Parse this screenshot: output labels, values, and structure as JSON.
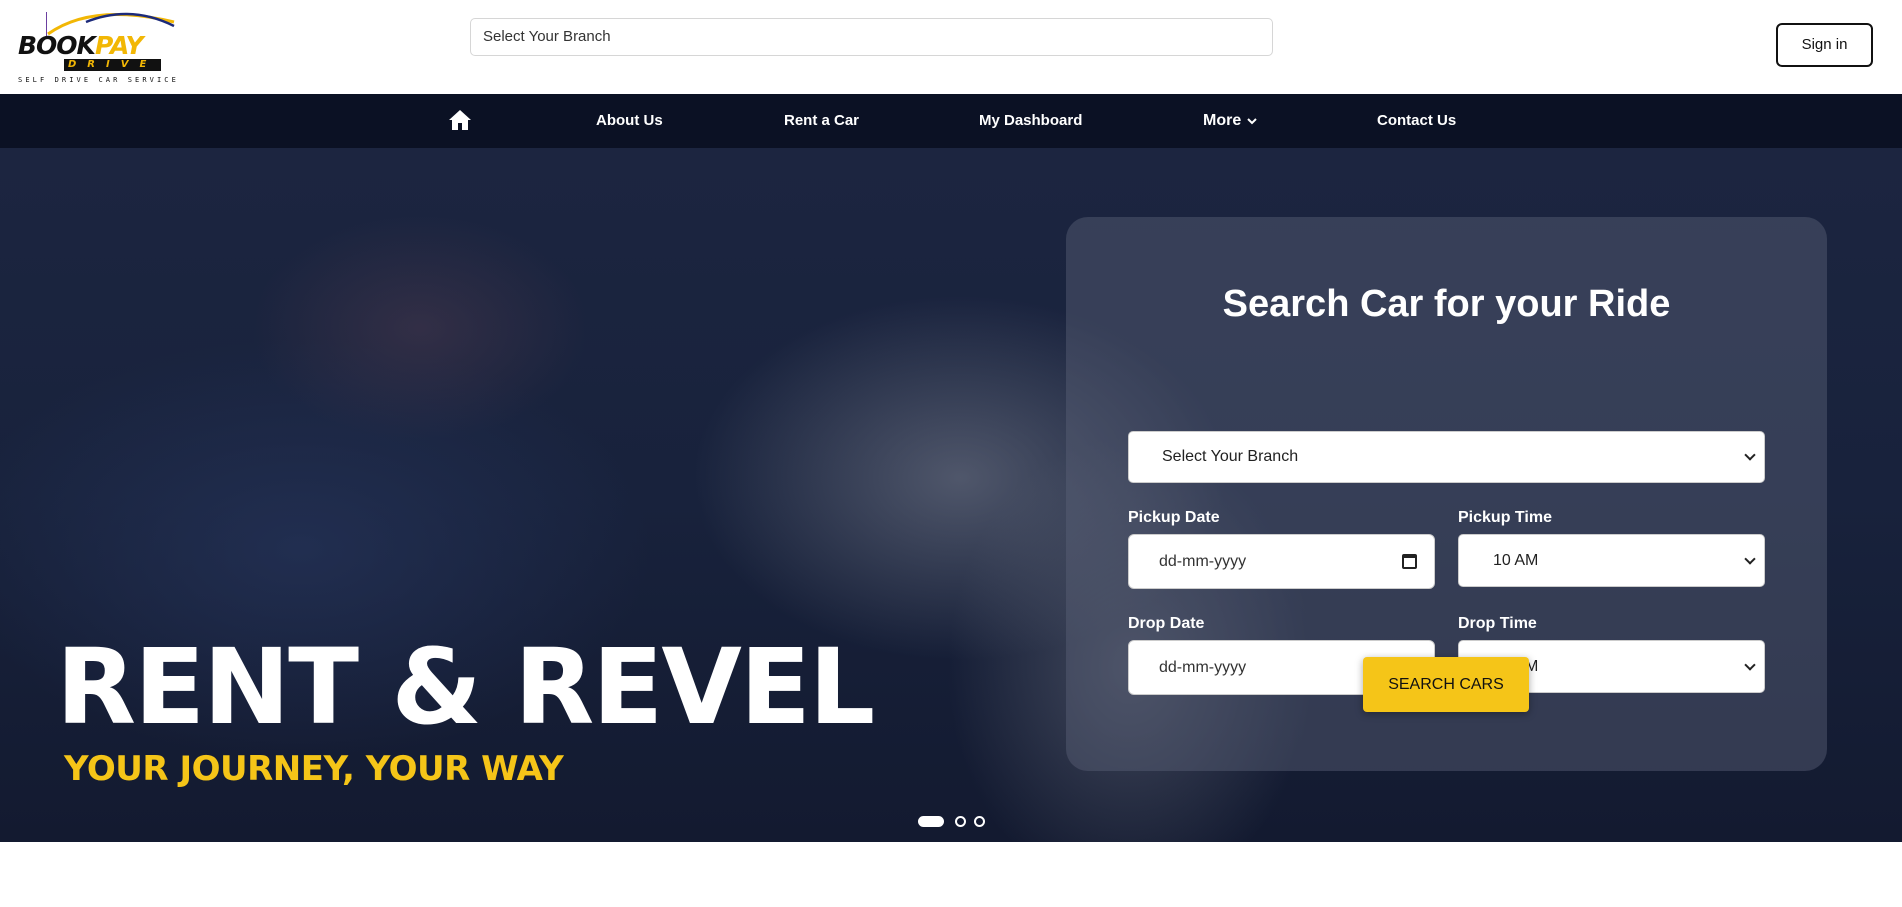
{
  "header": {
    "logo": {
      "word_part1": "BOOK",
      "word_part2": "PAY",
      "sub": "DRIVE",
      "tagline": "SELF DRIVE CAR SERVICE"
    },
    "branch_select": "Select Your Branch",
    "signin_label": "Sign in"
  },
  "nav": {
    "items": [
      "About Us",
      "Rent a Car",
      "My Dashboard",
      "More",
      "Contact Us"
    ],
    "home_icon": "home-icon",
    "more_icon": "chevron-down-icon"
  },
  "hero": {
    "title": "RENT & REVEL",
    "subtitle": "YOUR JOURNEY, YOUR WAY",
    "slides_count": 3,
    "active_slide": 1
  },
  "search": {
    "title": "Search Car for your Ride",
    "branch_value": "Select Your Branch",
    "pickup_date_label": "Pickup Date",
    "pickup_date_placeholder": "dd-mm-yyyy",
    "pickup_time_label": "Pickup Time",
    "pickup_time_value": "10 AM",
    "drop_date_label": "Drop Date",
    "drop_date_placeholder": "dd-mm-yyyy",
    "drop_time_label": "Drop Time",
    "drop_time_value": "10 AM",
    "button_label": "SEARCH CARS"
  },
  "colors": {
    "nav_bg": "#0b1124",
    "accent_yellow": "#f5c518",
    "white": "#ffffff"
  }
}
